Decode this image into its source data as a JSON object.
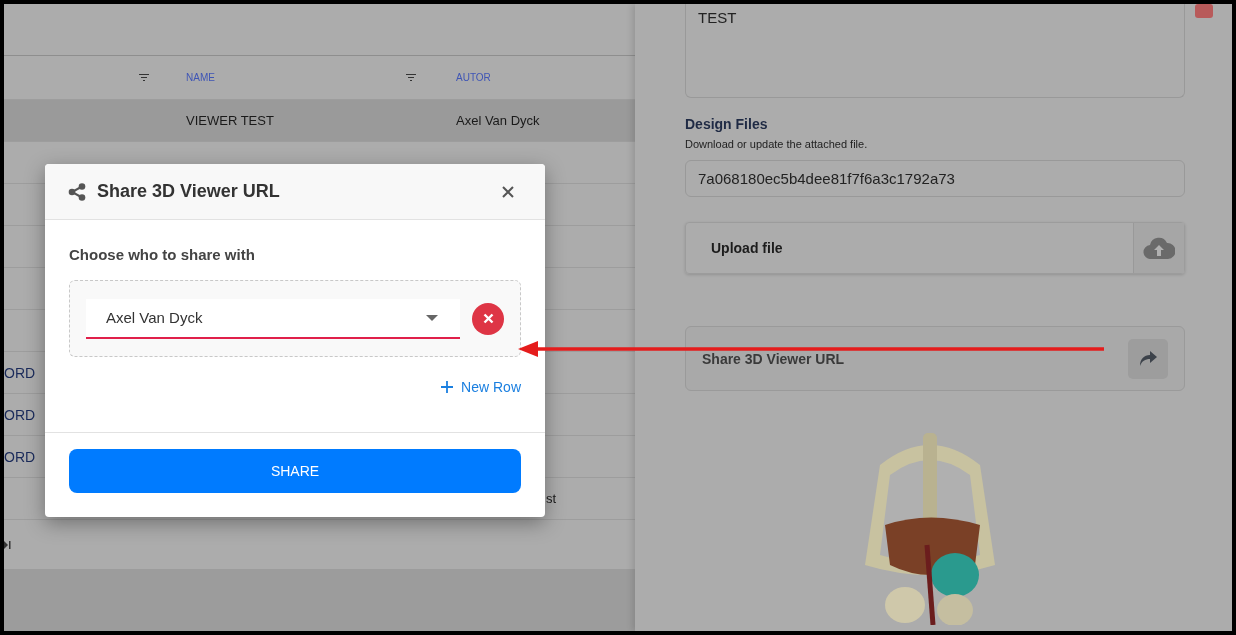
{
  "table": {
    "columns": [
      "NAME",
      "AUTOR"
    ],
    "rows": [
      {
        "selected": true,
        "name": "VIEWER TEST",
        "autor": "Axel Van Dyck"
      },
      {
        "selected": false
      },
      {
        "selected": false
      },
      {
        "selected": false
      },
      {
        "selected": false
      },
      {
        "selected": false
      },
      {
        "selected": false,
        "column_1": "ORD"
      },
      {
        "selected": false,
        "column_1": "ORD"
      },
      {
        "selected": false,
        "column_1": "ORD"
      },
      {
        "selected": false,
        "kind": "tail",
        "autor": "st"
      }
    ]
  },
  "detail": {
    "notes_value": "TEST",
    "design_files": {
      "title": "Design Files",
      "caption": "Download or update the attached file.",
      "file_id": "7a068180ec5b4dee81f7f6a3c1792a73",
      "upload_label": "Upload file"
    },
    "share_row": {
      "label": "Share 3D Viewer URL"
    }
  },
  "dialog": {
    "title": "Share 3D Viewer URL",
    "prompt": "Choose who to share with",
    "recipients": [
      {
        "value": "Axel Van Dyck"
      }
    ],
    "add_label": "New Row",
    "submit": "SHARE"
  }
}
